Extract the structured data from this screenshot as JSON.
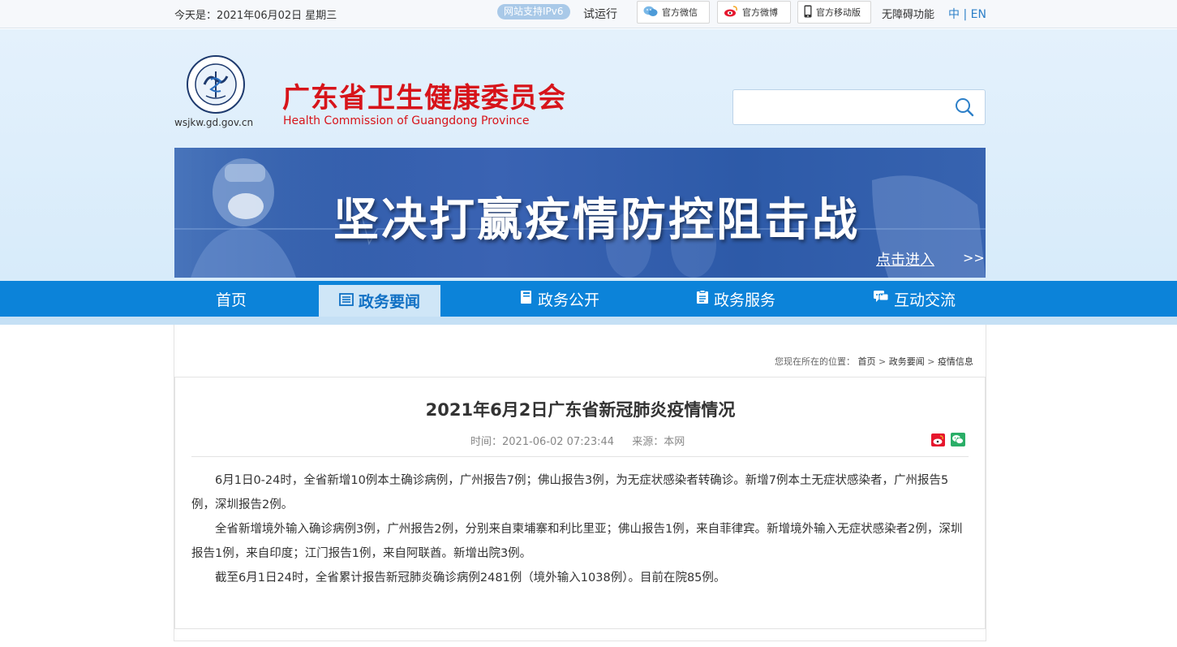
{
  "topbar": {
    "date": "今天是：2021年06月02日 星期三",
    "ipv6": "网站支持IPv6",
    "trial": "试运行",
    "wechat_label": "官方微信",
    "weibo_label": "官方微博",
    "mobile_label": "官方移动版",
    "accessibility": "无障碍功能",
    "lang_zh": "中",
    "lang_sep": "|",
    "lang_en": "EN"
  },
  "header": {
    "domain": "wsjkw.gd.gov.cn",
    "title": "广东省卫生健康委员会",
    "subtitle": "Health Commission of Guangdong Province",
    "title_color": "#d7141a"
  },
  "search": {
    "value": "",
    "placeholder": ""
  },
  "banner": {
    "title": "坚决打赢疫情防控阻击战",
    "link": "点击进入",
    "arrows": ">>"
  },
  "nav": {
    "items": [
      {
        "label": "首页",
        "icon": "none"
      },
      {
        "label": "政务要闻",
        "icon": "list-icon",
        "active": true
      },
      {
        "label": "政务公开",
        "icon": "book-icon"
      },
      {
        "label": "政务服务",
        "icon": "clipboard-icon"
      },
      {
        "label": "互动交流",
        "icon": "chat-icon"
      }
    ],
    "color": "#0c83d9"
  },
  "breadcrumb": {
    "prefix": "您现在所在的位置：",
    "items": [
      "首页",
      "政务要闻",
      "疫情信息"
    ],
    "sep": ">"
  },
  "article": {
    "title": "2021年6月2日广东省新冠肺炎疫情情况",
    "time": "时间：2021-06-02 07:23:44",
    "source": "来源：本网",
    "paragraphs": [
      "6月1日0-24时，全省新增10例本土确诊病例，广州报告7例；佛山报告3例，为无症状感染者转确诊。新增7例本土无症状感染者，广州报告5例，深圳报告2例。",
      "全省新增境外输入确诊病例3例，广州报告2例，分别来自柬埔寨和利比里亚；佛山报告1例，来自菲律宾。新增境外输入无症状感染者2例，深圳报告1例，来自印度；江门报告1例，来自阿联酋。新增出院3例。",
      "截至6月1日24时，全省累计报告新冠肺炎确诊病例2481例（境外输入1038例）。目前在院85例。"
    ]
  }
}
